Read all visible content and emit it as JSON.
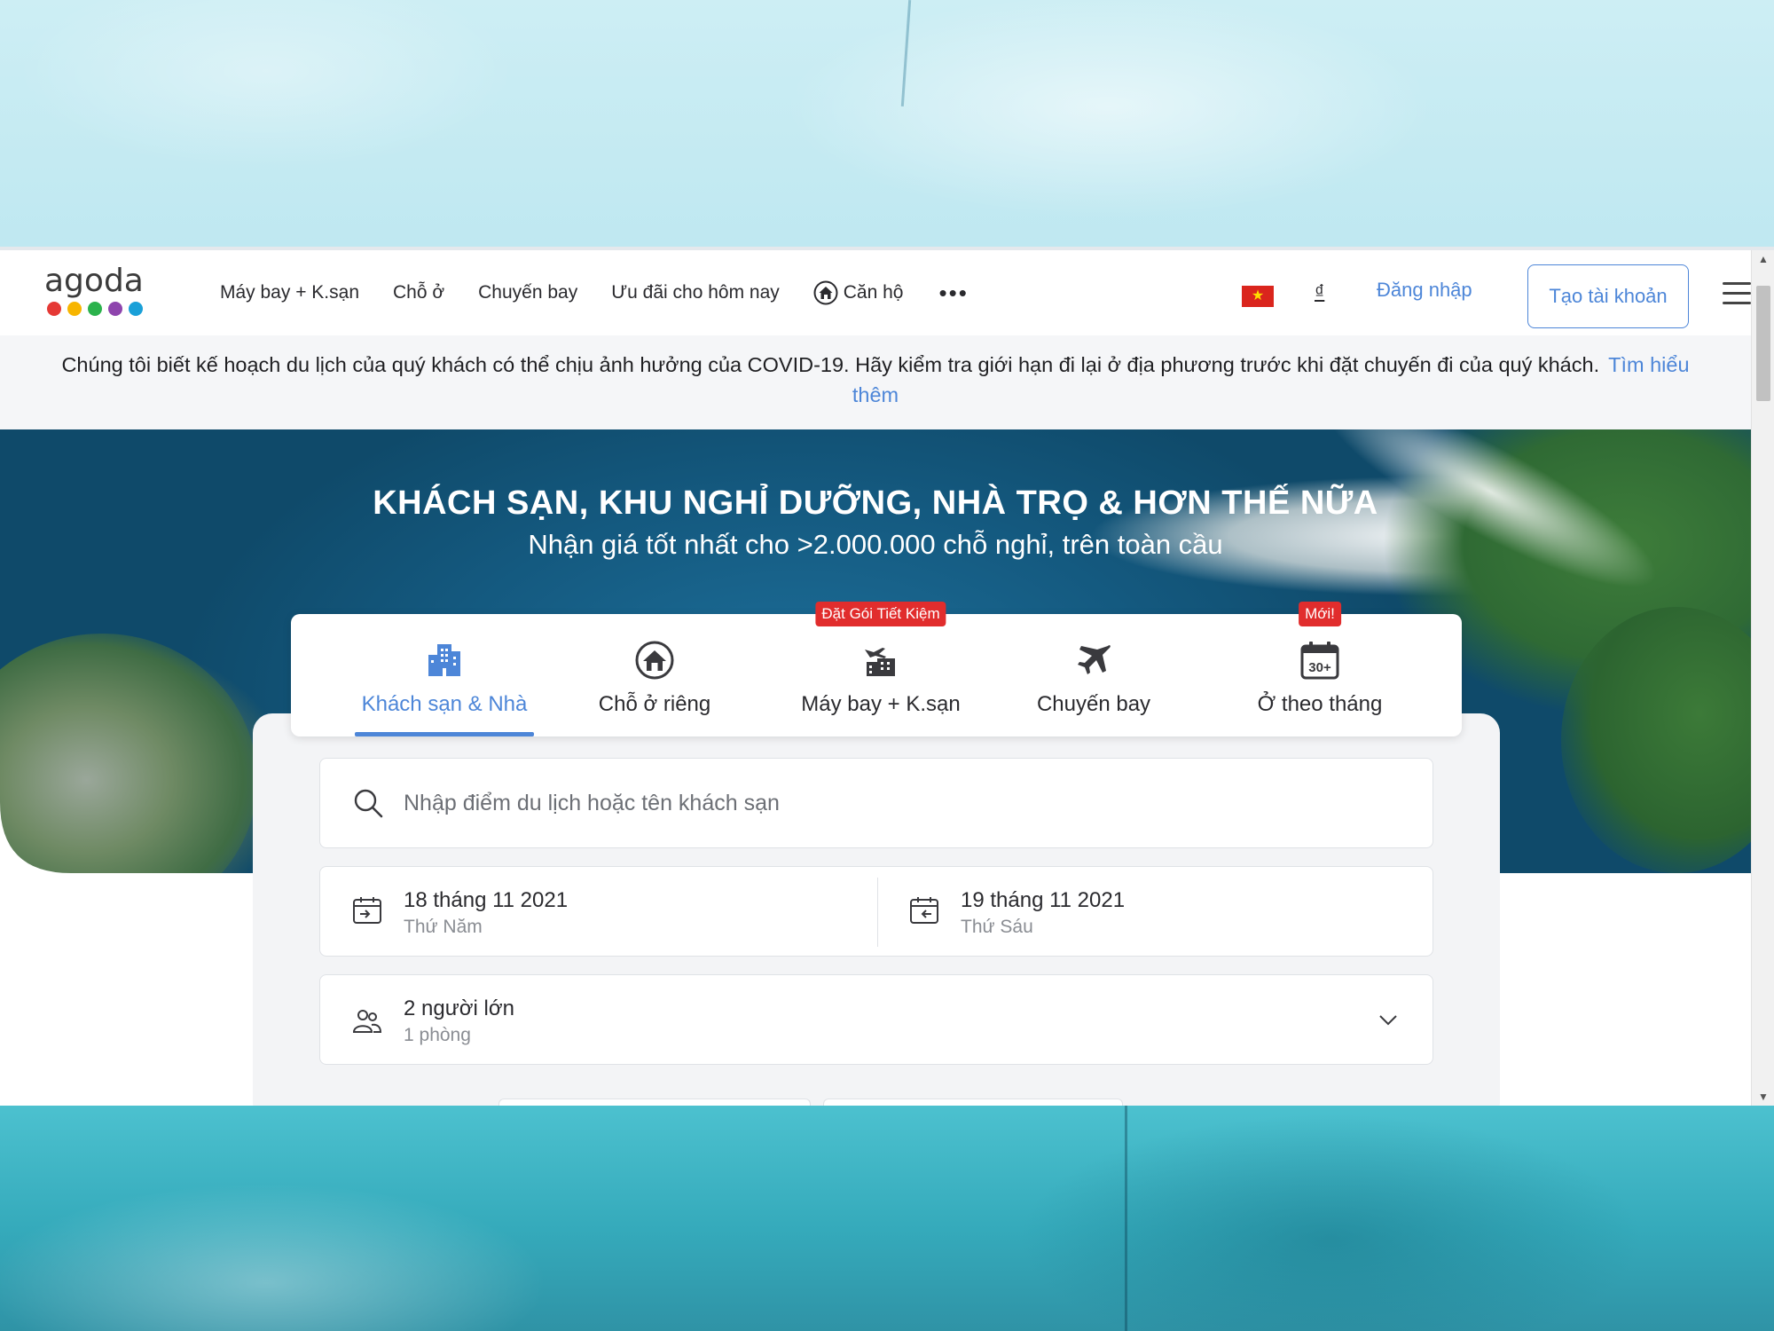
{
  "header": {
    "logo_text": "agoda",
    "logo_dot_colors": [
      "#e53935",
      "#f7b500",
      "#2bb24c",
      "#8e44ad",
      "#1aa0d8"
    ],
    "nav": [
      {
        "label": "Máy bay + K.sạn"
      },
      {
        "label": "Chỗ ở"
      },
      {
        "label": "Chuyến bay"
      },
      {
        "label": "Ưu đãi cho hôm nay"
      },
      {
        "label": "Căn hộ",
        "icon": "home-icon"
      }
    ],
    "more_label": "•••",
    "currency": "₫",
    "login_label": "Đăng nhập",
    "signup_label": "Tạo tài khoản"
  },
  "banner": {
    "text": "Chúng tôi biết kế hoạch du lịch của quý khách có thể chịu ảnh hưởng của COVID-19. Hãy kiểm tra giới hạn đi lại ở địa phương trước khi đặt chuyến đi của quý khách.",
    "link": "Tìm hiểu thêm"
  },
  "hero": {
    "title": "KHÁCH SẠN, KHU NGHỈ DƯỠNG, NHÀ TRỌ & HƠN THẾ NỮA",
    "subtitle": "Nhận giá tốt nhất cho >2.000.000 chỗ nghỉ, trên toàn cầu"
  },
  "tabs": [
    {
      "label": "Khách sạn & Nhà",
      "icon": "hotel-building-icon",
      "active": true
    },
    {
      "label": "Chỗ ở riêng",
      "icon": "home-icon"
    },
    {
      "label": "Máy bay + K.sạn",
      "icon": "flight-hotel-icon",
      "badge": "Đặt Gói Tiết Kiệm"
    },
    {
      "label": "Chuyến bay",
      "icon": "airplane-icon"
    },
    {
      "label": "Ở theo tháng",
      "icon": "calendar-30-icon",
      "badge": "Mới!"
    }
  ],
  "search": {
    "placeholder": "Nhập điểm du lịch hoặc tên khách sạn"
  },
  "dates": {
    "checkin": {
      "date": "18 tháng 11 2021",
      "weekday": "Thứ Năm"
    },
    "checkout": {
      "date": "19 tháng 11 2021",
      "weekday": "Thứ Sáu"
    }
  },
  "guests": {
    "main": "2 người lớn",
    "sub": "1 phòng"
  },
  "colors": {
    "accent": "#4d86d8",
    "badge": "#e12d2d"
  }
}
